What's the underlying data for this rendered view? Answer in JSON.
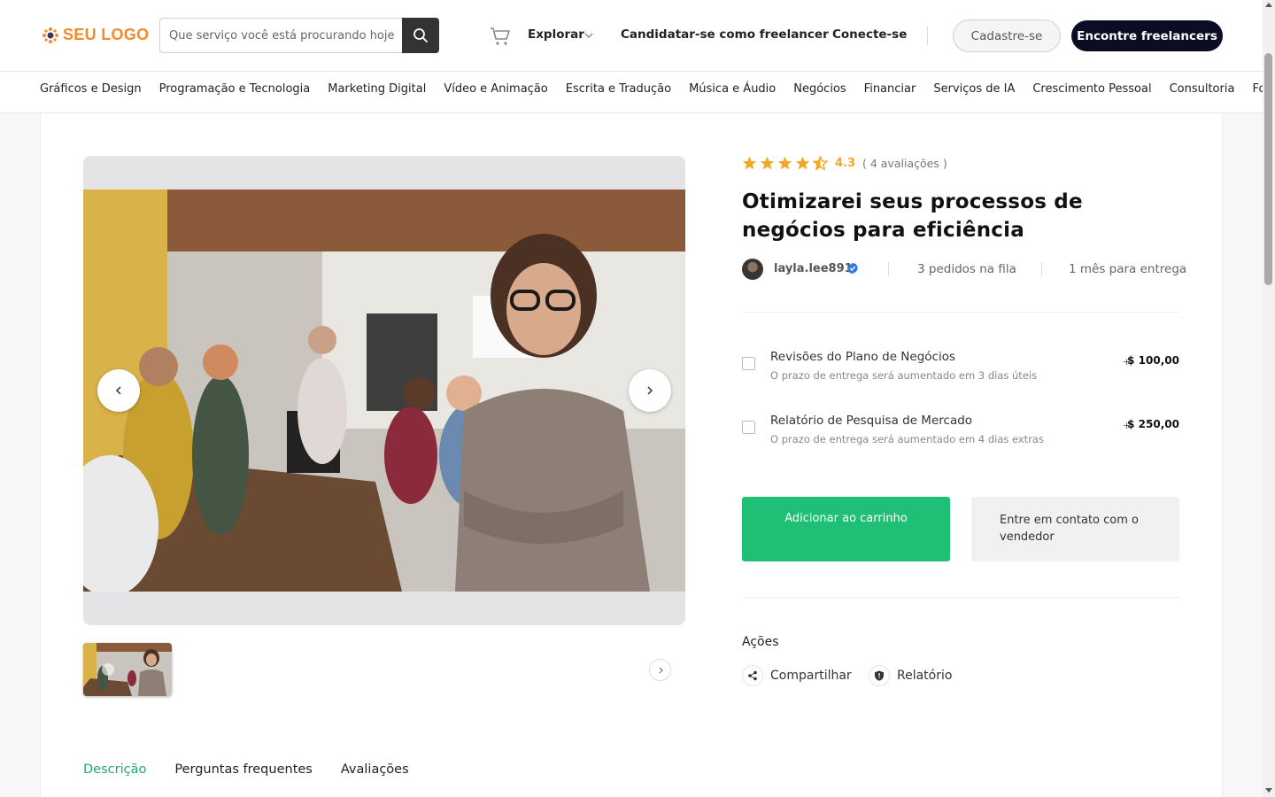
{
  "header": {
    "logo_text": "SEU LOGO",
    "search": {
      "placeholder": "Que serviço você está procurando hoje?"
    },
    "nav": {
      "explore": "Explorar",
      "apply_freelancer": "Candidatar-se como freelancer",
      "connect": "Conecte-se"
    },
    "signup": "Cadastre-se",
    "find_freelancers": "Encontre freelancers"
  },
  "categories": [
    "Gráficos e Design",
    "Programação e Tecnologia",
    "Marketing Digital",
    "Vídeo e Animação",
    "Escrita e Tradução",
    "Música e Áudio",
    "Negócios",
    "Financiar",
    "Serviços de IA",
    "Crescimento Pessoal",
    "Consultoria",
    "Fot"
  ],
  "product": {
    "rating": {
      "value": "4.3",
      "stars": 4.5,
      "count_text": "( 4 avaliações )"
    },
    "title": "Otimizarei seus processos de negócios para eficiência",
    "seller": "layla.lee891",
    "queue": "3 pedidos na fila",
    "delivery": "1 mês para entrega",
    "extras": [
      {
        "title": "Revisões do Plano de Negócios",
        "sub": "O prazo de entrega será aumentado em 3 dias úteis",
        "plus": "+",
        "price": "$ 100,00"
      },
      {
        "title": "Relatório de Pesquisa de Mercado",
        "sub": "O prazo de entrega será aumentado em 4 dias extras",
        "plus": "+",
        "price": "$ 250,00"
      }
    ],
    "add_to_cart": "Adicionar ao carrinho",
    "contact_seller": "Entre em contato com o vendedor",
    "actions_title": "Ações",
    "share": "Compartilhar",
    "report": "Relatório"
  },
  "tabs": [
    "Descrição",
    "Perguntas frequentes",
    "Avaliações"
  ],
  "colors": {
    "accent_green": "#1fbf75",
    "tab_active": "#1fa67a",
    "star": "#f5a623",
    "dark_button": "#0c0c22",
    "logo_orange": "#f28c28"
  }
}
